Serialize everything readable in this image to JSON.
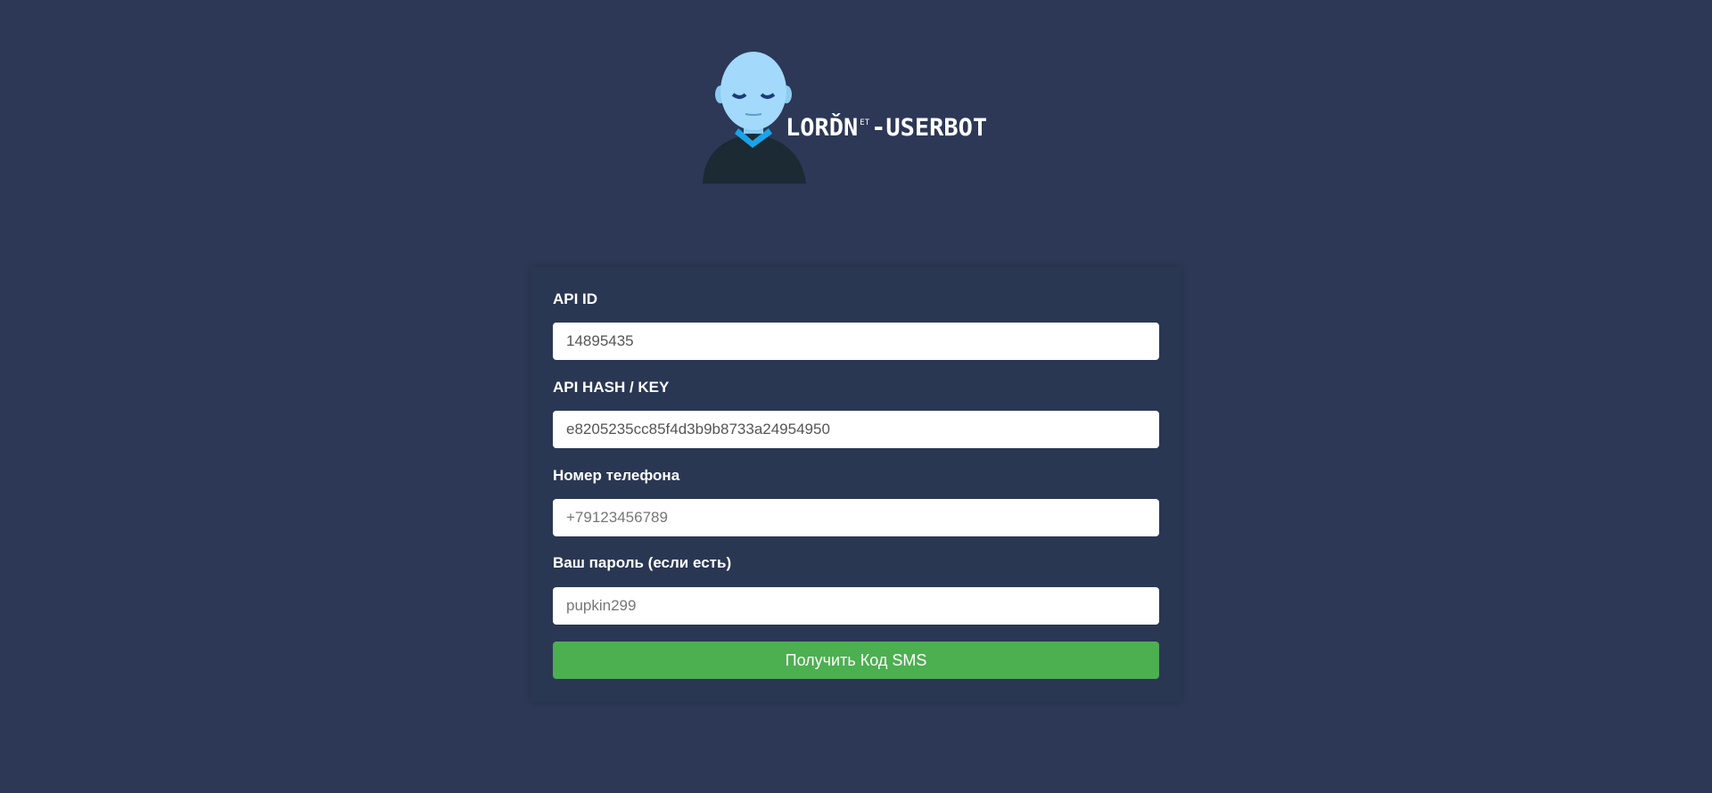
{
  "logo": {
    "brand_main": "LORĎN",
    "brand_sup": "ET",
    "brand_suffix": "-USERBOT",
    "colors": {
      "skin": "#a3d9fb",
      "collar": "#1aa3e8",
      "body": "#1b2a33"
    }
  },
  "form": {
    "api_id": {
      "label": "API ID",
      "value": "14895435",
      "placeholder": ""
    },
    "api_hash": {
      "label": "API HASH / KEY",
      "value": "e8205235cc85f4d3b9b8733a24954950",
      "placeholder": ""
    },
    "phone": {
      "label": "Номер телефона",
      "value": "",
      "placeholder": "+79123456789"
    },
    "password": {
      "label": "Ваш пароль (если есть)",
      "value": "",
      "placeholder": "pupkin299"
    },
    "submit_label": "Получить Код SMS"
  },
  "colors": {
    "page_background": "#2c3856",
    "card_background": "#2a3753",
    "button_accent": "#4caf50"
  }
}
